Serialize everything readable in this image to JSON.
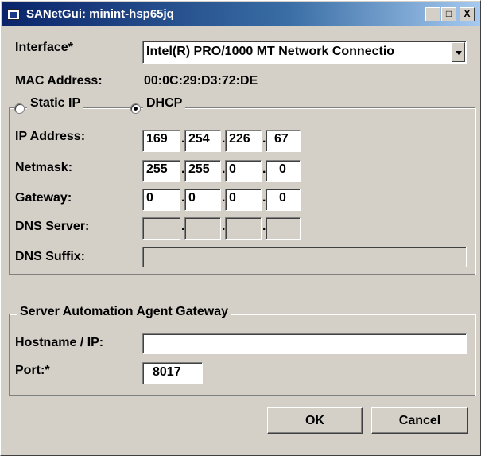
{
  "window": {
    "title": "SANetGui: minint-hsp65jq",
    "minimize_glyph": "_",
    "maximize_glyph": "□",
    "close_glyph": "X"
  },
  "interface": {
    "label": "Interface*",
    "value": "Intel(R) PRO/1000 MT Network Connectio"
  },
  "mac": {
    "label": "MAC Address:",
    "value": "00:0C:29:D3:72:DE"
  },
  "ip_mode": {
    "static_label": "Static IP",
    "dhcp_label": "DHCP",
    "selected": "DHCP"
  },
  "network": {
    "ip_label": "IP Address:",
    "ip": [
      "169",
      "254",
      "226",
      "67"
    ],
    "netmask_label": "Netmask:",
    "netmask": [
      "255",
      "255",
      "0",
      "0"
    ],
    "gateway_label": "Gateway:",
    "gateway": [
      "0",
      "0",
      "0",
      "0"
    ],
    "dns_label": "DNS Server:",
    "dns": [
      "",
      "",
      "",
      ""
    ],
    "suffix_label": "DNS Suffix:",
    "suffix": ""
  },
  "agent_gateway": {
    "title": "Server Automation Agent Gateway",
    "host_label": "Hostname / IP:",
    "host": "",
    "port_label": "Port:*",
    "port": "8017"
  },
  "buttons": {
    "ok": "OK",
    "cancel": "Cancel"
  }
}
